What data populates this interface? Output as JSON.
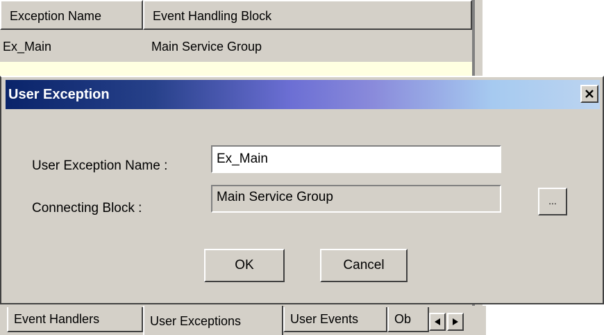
{
  "table": {
    "columns": [
      "Exception Name",
      "Event Handling Block"
    ],
    "rows": [
      {
        "name": "Ex_Main",
        "block": "Main Service Group"
      }
    ]
  },
  "dialog": {
    "title": "User Exception",
    "close_icon": "close-x-icon",
    "name_label": "User Exception Name :",
    "name_value": "Ex_Main",
    "connecting_label": "Connecting Block :",
    "connecting_value": "Main Service Group",
    "browse_label": "...",
    "ok_label": "OK",
    "cancel_label": "Cancel"
  },
  "tabs": [
    {
      "label": "Event Handlers",
      "active": false
    },
    {
      "label": "User Exceptions",
      "active": true
    },
    {
      "label": "User Events",
      "active": false
    },
    {
      "label": "Ob",
      "active": false
    }
  ],
  "tab_scroll": {
    "left_icon": "arrow-left-icon",
    "right_icon": "arrow-right-icon"
  },
  "colors": {
    "window_face": "#d4d0c8",
    "highlight_row": "#ffffe1",
    "titlebar_start": "#0a246a",
    "titlebar_end": "#bcd4f0",
    "title_text": "#ffffff"
  }
}
